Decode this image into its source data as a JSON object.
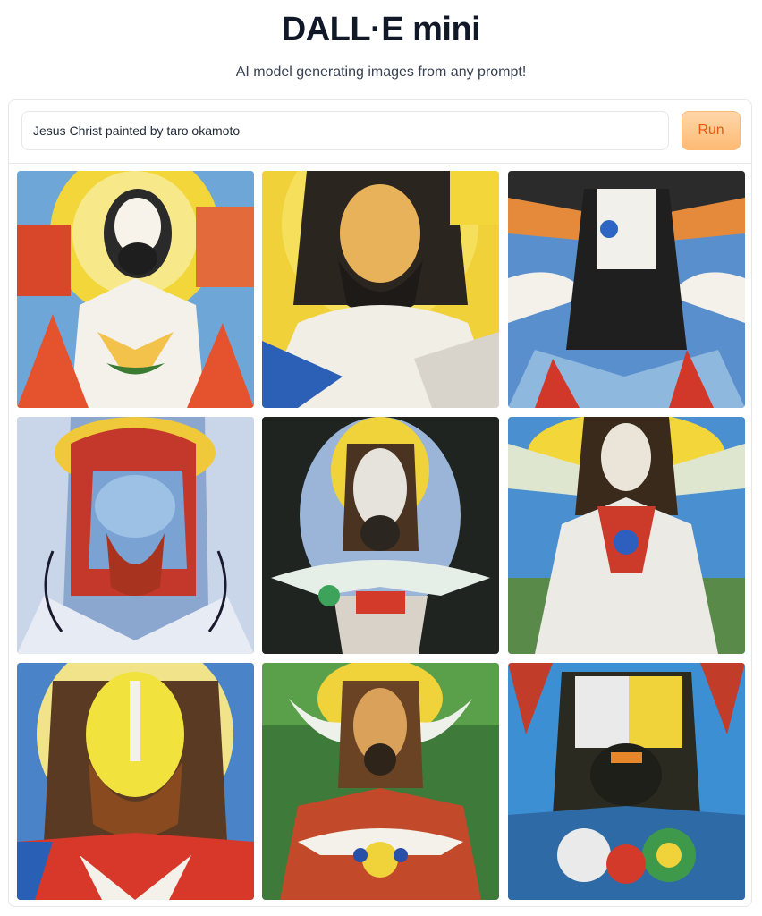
{
  "header": {
    "title": "DALL·E mini",
    "subtitle": "AI model generating images from any prompt!"
  },
  "prompt": {
    "value": "Jesus Christ painted by taro okamoto"
  },
  "run_button": {
    "label": "Run"
  },
  "colors": {
    "accent": "#ea580c",
    "button_bg": "#fdba74",
    "border": "#e5e7eb"
  },
  "gallery": {
    "count": 9
  }
}
